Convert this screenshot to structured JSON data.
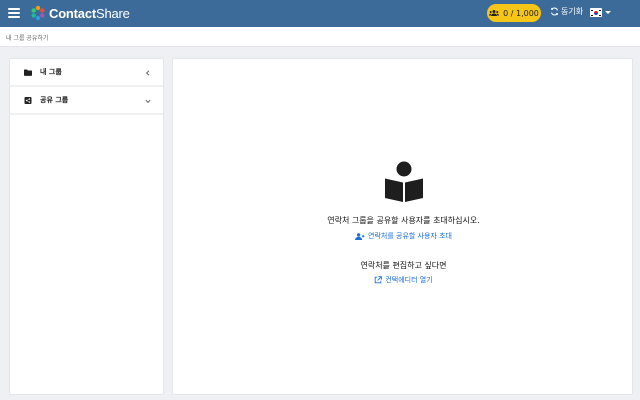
{
  "header": {
    "logo_bold": "Contact",
    "logo_thin": "Share",
    "counter": "0 / 1,000",
    "sync_label": "동기화",
    "colors": {
      "bar": "#3d6b99",
      "counter_bg": "#f5c518"
    }
  },
  "breadcrumb": "내 그룹 공유하기",
  "sidebar": {
    "items": [
      {
        "label": "내 그룹",
        "icon": "folder-icon",
        "chevron": "chevron-left-icon"
      },
      {
        "label": "공유 그룹",
        "icon": "share-icon",
        "chevron": "chevron-down-icon"
      }
    ]
  },
  "main": {
    "invite_text": "연락처 그룹을 공유할 사용자를 초대하십시오.",
    "invite_link": "연락처를 공유할 사용자 초대",
    "edit_text": "연락처를 편집하고 싶다면",
    "edit_link": "컨택에디터 열기",
    "link_color": "#1a6fd8"
  }
}
